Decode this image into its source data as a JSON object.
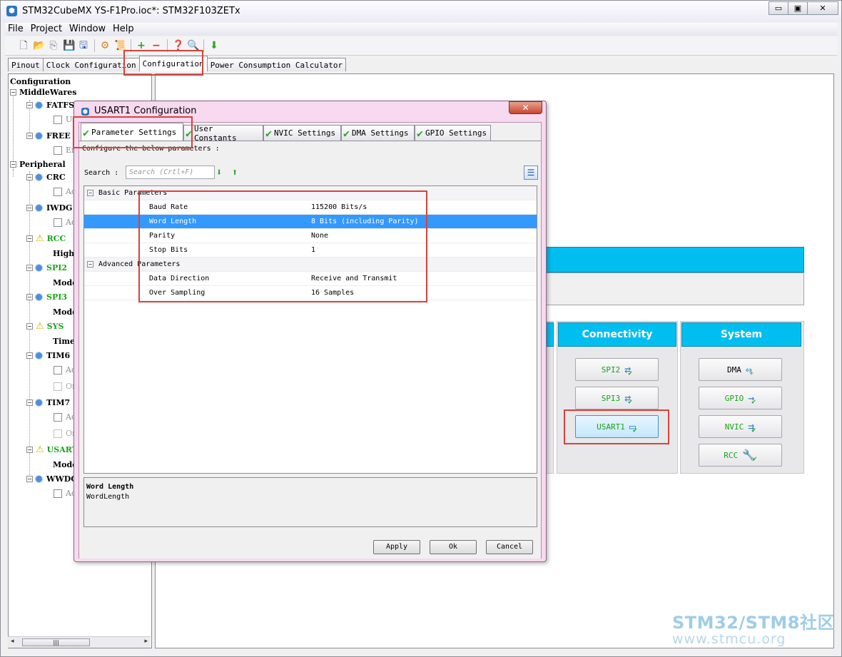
{
  "window": {
    "title": "STM32CubeMX YS-F1Pro.ioc*: STM32F103ZETx",
    "minimize": "▭",
    "maximize": "▣",
    "close": "✕"
  },
  "menu": [
    "File",
    "Project",
    "Window",
    "Help"
  ],
  "main_tabs": [
    "Pinout",
    "Clock Configuration",
    "Configuration",
    "Power Consumption Calculator"
  ],
  "tree": {
    "root": "Configuration",
    "middlewares": "MiddleWares",
    "fatfs": "FATFS",
    "fatfs_child": "Us",
    "freertos": "FREE",
    "freertos_child": "En",
    "peripherals": "Peripheral",
    "crc": "CRC",
    "crc_child": "Ac",
    "iwdg": "IWDG",
    "iwdg_child": "Ac",
    "rcc": "RCC",
    "rcc_child": "High",
    "spi2": "SPI2",
    "spi2_child": "Mode",
    "spi3": "SPI3",
    "spi3_child": "Mode",
    "sys": "SYS",
    "sys_child": "Time",
    "tim6": "TIM6",
    "tim6_c1": "Ac",
    "tim6_c2": "On",
    "tim7": "TIM7",
    "tim7_c1": "Ac",
    "tim7_c2": "On",
    "usart1": "USART",
    "usart1_child": "Mode",
    "wwdg": "WWDG",
    "wwdg_child": "Ac"
  },
  "categories": {
    "connectivity": {
      "title": "Connectivity",
      "buttons": [
        "SPI2",
        "SPI3",
        "USART1"
      ]
    },
    "system": {
      "title": "System",
      "buttons": [
        "DMA",
        "GPIO",
        "NVIC",
        "RCC"
      ]
    }
  },
  "dialog": {
    "title": "USART1 Configuration",
    "close": "✕",
    "tabs": [
      "Parameter Settings",
      "User Constants",
      "NVIC Settings",
      "DMA Settings",
      "GPIO Settings"
    ],
    "instruction": "Configure the below parameters :",
    "search_label": "Search :",
    "search_placeholder": "Search (Crtl+F)",
    "groups": [
      {
        "name": "Basic Parameters",
        "params": [
          {
            "name": "Baud Rate",
            "value": "115200 Bits/s"
          },
          {
            "name": "Word Length",
            "value": "8 Bits (including Parity)"
          },
          {
            "name": "Parity",
            "value": "None"
          },
          {
            "name": "Stop Bits",
            "value": "1"
          }
        ]
      },
      {
        "name": "Advanced Parameters",
        "params": [
          {
            "name": "Data Direction",
            "value": "Receive and Transmit"
          },
          {
            "name": "Over Sampling",
            "value": "16 Samples"
          }
        ]
      }
    ],
    "description": {
      "title": "Word Length",
      "body": "WordLength"
    },
    "buttons": {
      "apply": "Apply",
      "ok": "Ok",
      "cancel": "Cancel"
    }
  },
  "watermark": {
    "line1": "STM32/STM8社区",
    "line2": "www.stmcu.org"
  },
  "colors": {
    "accent": "#00bff0",
    "highlight": "#d8423a",
    "selection": "#3399ff",
    "ok_green": "#1aa31a"
  }
}
